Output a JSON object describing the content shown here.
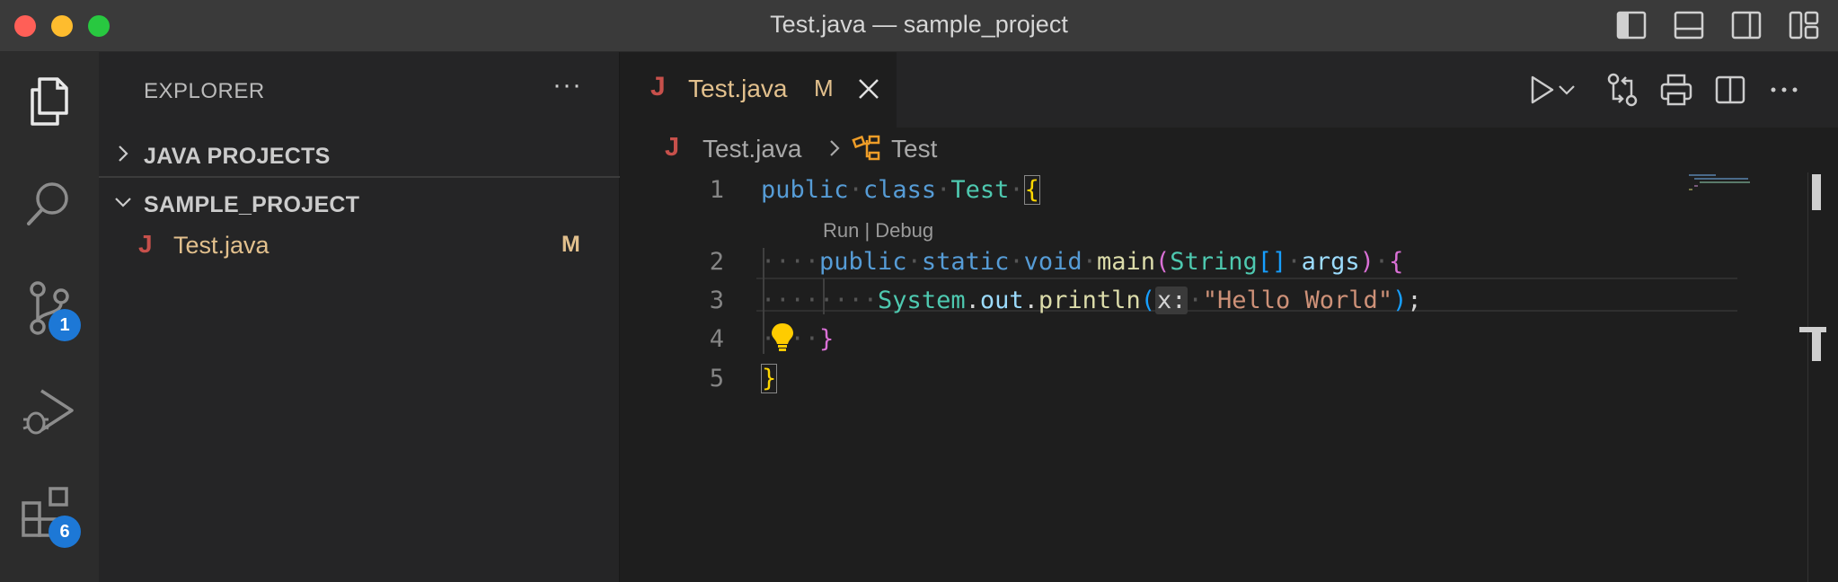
{
  "window": {
    "title": "Test.java — sample_project",
    "layout_controls": [
      "toggle-primary-sidebar-icon",
      "toggle-panel-icon",
      "toggle-secondary-sidebar-icon",
      "customize-layout-icon"
    ]
  },
  "activity_bar": {
    "items": [
      {
        "name": "explorer",
        "icon": "files-icon"
      },
      {
        "name": "search",
        "icon": "search-icon"
      },
      {
        "name": "source-control",
        "icon": "source-control-icon",
        "badge": "1"
      },
      {
        "name": "run-debug",
        "icon": "run-debug-icon"
      },
      {
        "name": "extensions",
        "icon": "extensions-icon",
        "badge": "6"
      }
    ]
  },
  "sidebar": {
    "title": "EXPLORER",
    "more": "···",
    "sections": [
      {
        "label": "JAVA PROJECTS",
        "expanded": false
      },
      {
        "label": "SAMPLE_PROJECT",
        "expanded": true
      }
    ],
    "files": [
      {
        "icon": "J",
        "name": "Test.java",
        "status": "M"
      }
    ]
  },
  "editor": {
    "tab": {
      "icon": "J",
      "name": "Test.java",
      "status": "M"
    },
    "actions": [
      "run-icon",
      "run-dropdown-icon",
      "compare-changes-icon",
      "print-icon",
      "split-editor-icon",
      "more-actions-icon"
    ],
    "breadcrumb": {
      "file_icon": "J",
      "file": "Test.java",
      "symbol": "Test"
    },
    "codelens": "Run | Debug",
    "line_numbers": [
      "1",
      "2",
      "3",
      "4",
      "5"
    ],
    "code": {
      "l1": {
        "kw1": "public",
        "kw2": "class",
        "cls": "Test",
        "brace": "{"
      },
      "l2": {
        "kw1": "public",
        "kw2": "static",
        "kw3": "void",
        "fn": "main",
        "paren_open": "(",
        "type": "String",
        "arr": "[]",
        "param": "args",
        "paren_close": ")",
        "brace": "{"
      },
      "l3": {
        "cls": "System",
        "dot1": ".",
        "field": "out",
        "dot2": ".",
        "fn": "println",
        "paren_open": "(",
        "hint": "x:",
        "str": "\"Hello World\"",
        "paren_close": ")",
        "semi": ";"
      },
      "l4": {
        "brace": "}"
      },
      "l5": {
        "brace": "}"
      }
    }
  },
  "colors": {
    "accent_badge": "#1d78d6",
    "java_icon": "#c7504b",
    "modified": "#e2c08d"
  }
}
